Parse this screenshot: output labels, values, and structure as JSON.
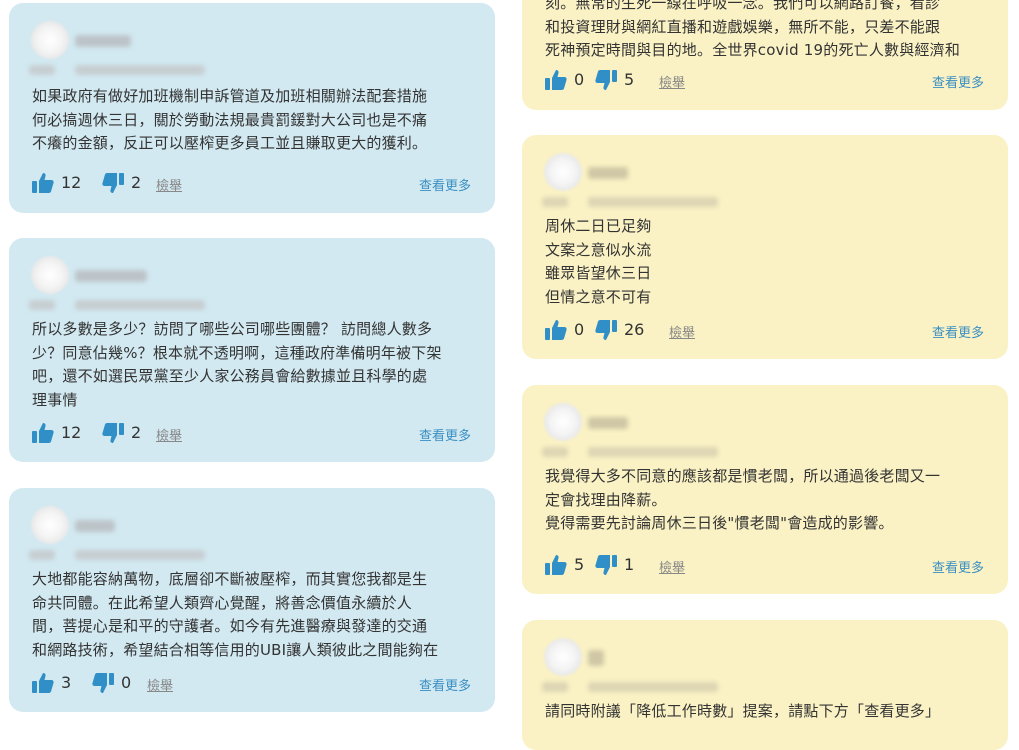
{
  "colors": {
    "card_blue": "#d2e9f1",
    "card_yellow": "#faf2c4",
    "icon_blue": "#2f8fc6",
    "link_blue": "#3a8fc3"
  },
  "icons": {
    "like": "thumbs-up-icon",
    "dislike": "thumbs-down-icon"
  },
  "left_cards": [
    {
      "lines": [
        "如果政府有做好加班機制申訴管道及加班相關辦法配套措施",
        "何必搞週休三日，關於勞動法規最貴罰鍰對大公司也是不痛",
        "不癢的金額，反正可以壓榨更多員工並且賺取更大的獲利。"
      ],
      "likes": "12",
      "dislikes": "2",
      "report": "檢舉",
      "more": "查看更多"
    },
    {
      "lines": [
        "所以多數是多少？訪問了哪些公司哪些團體？ 訪問總人數多",
        "少？同意佔幾%？根本就不透明啊，這種政府準備明年被下架",
        "吧，還不如選民眾黨至少人家公務員會給數據並且科學的處",
        "理事情"
      ],
      "likes": "12",
      "dislikes": "2",
      "report": "檢舉",
      "more": "查看更多"
    },
    {
      "lines": [
        "大地都能容納萬物，底層卻不斷被壓榨，而其實您我都是生",
        "命共同體。在此希望人類齊心覺醒，將善念價值永續於人",
        "間，菩提心是和平的守護者。如今有先進醫療與發達的交通",
        "和網路技術，希望結合相等信用的UBI讓人類彼此之間能夠在"
      ],
      "likes": "3",
      "dislikes": "0",
      "report": "檢舉",
      "more": "查看更多"
    }
  ],
  "right_cards": [
    {
      "lines": [
        "刻。無常的生死一線在呼吸一念。我們可以網路訂餐，看診",
        "和投資理財與網紅直播和遊戲娛樂，無所不能，只差不能跟",
        "死神預定時間與目的地。全世界covid 19的死亡人數與經濟和"
      ],
      "likes": "0",
      "dislikes": "5",
      "report": "檢舉",
      "more": "查看更多"
    },
    {
      "lines": [
        "周休二日已足夠",
        "文案之意似水流",
        "雖眾皆望休三日",
        "但情之意不可有"
      ],
      "likes": "0",
      "dislikes": "26",
      "report": "檢舉",
      "more": "查看更多"
    },
    {
      "lines": [
        "我覺得大多不同意的應該都是慣老闆，所以通過後老闆又一",
        "定會找理由降薪。",
        "覺得需要先討論周休三日後\"慣老闆\"會造成的影響。"
      ],
      "likes": "5",
      "dislikes": "1",
      "report": "檢舉",
      "more": "查看更多"
    },
    {
      "lines": [
        "請同時附議「降低工作時數」提案，請點下方「查看更多」"
      ]
    }
  ]
}
